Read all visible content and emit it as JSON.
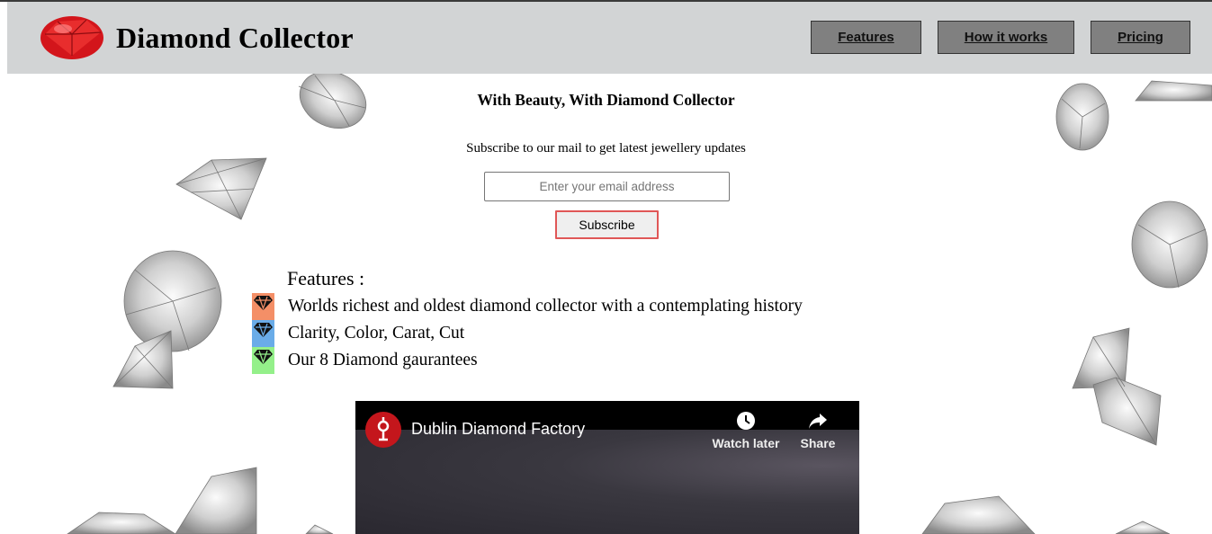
{
  "header": {
    "brand": "Diamond Collector",
    "nav": [
      {
        "label": "Features"
      },
      {
        "label": "How it works"
      },
      {
        "label": "Pricing"
      }
    ]
  },
  "hero": {
    "tagline": "With Beauty, With Diamond Collector",
    "subscribe_text": "Subscribe to our mail to get latest jewellery updates",
    "email_placeholder": "Enter your email address",
    "subscribe_label": "Subscribe"
  },
  "features": {
    "title": "Features :",
    "items": [
      {
        "text": "Worlds richest and oldest diamond collector with a contemplating history",
        "icon": "diamond-icon",
        "color": "#f48f67"
      },
      {
        "text": "Clarity, Color, Carat, Cut",
        "icon": "diamond-icon",
        "color": "#6aace8"
      },
      {
        "text": "Our 8 Diamond gaurantees",
        "icon": "diamond-icon",
        "color": "#94f08a"
      }
    ]
  },
  "video": {
    "title": "Dublin Diamond Factory",
    "watch_later": "Watch later",
    "share": "Share"
  },
  "colors": {
    "header_bg": "#d2d4d5",
    "nav_bg": "#808080",
    "subscribe_border": "#e05757",
    "logo_red": "#c4161c"
  }
}
